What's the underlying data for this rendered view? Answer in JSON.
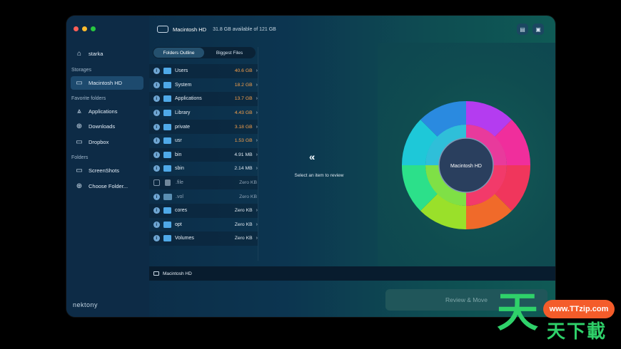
{
  "window": {
    "lights": [
      "#ff5f57",
      "#febc2e",
      "#28c840"
    ]
  },
  "sidebar": {
    "user": {
      "icon": "home-icon",
      "label": "starka"
    },
    "storages_heading": "Storages",
    "storage_item": {
      "icon": "drive-icon",
      "label": "Macintosh HD"
    },
    "favorites_heading": "Favorite folders",
    "favorites": [
      {
        "icon": "applications-icon",
        "label": "Applications"
      },
      {
        "icon": "download-icon",
        "label": "Downloads"
      },
      {
        "icon": "folder-icon",
        "label": "Dropbox"
      }
    ],
    "folders_heading": "Folders",
    "folders": [
      {
        "icon": "folder-icon",
        "label": "ScreenShots"
      },
      {
        "icon": "plus-circle-icon",
        "label": "Choose Folder..."
      }
    ],
    "brand": "nektony"
  },
  "topbar": {
    "title": "Macintosh HD",
    "available": "31.8 GB available of 121 GB"
  },
  "tabs": [
    "Folders Outline",
    "Biggest Files"
  ],
  "rows": [
    {
      "name": "Users",
      "size": "40.6 GB",
      "kind": "folder",
      "size_style": "warn"
    },
    {
      "name": "System",
      "size": "18.2 GB",
      "kind": "folder",
      "size_style": "warn"
    },
    {
      "name": "Applications",
      "size": "13.7 GB",
      "kind": "folder",
      "size_style": "warn"
    },
    {
      "name": "Library",
      "size": "4.43 GB",
      "kind": "folder",
      "size_style": "warn"
    },
    {
      "name": "private",
      "size": "3.18 GB",
      "kind": "folder",
      "size_style": "warn"
    },
    {
      "name": "usr",
      "size": "1.53 GB",
      "kind": "folder",
      "size_style": "warn"
    },
    {
      "name": "bin",
      "size": "4.91 MB",
      "kind": "folder",
      "size_style": "norm"
    },
    {
      "name": "sbin",
      "size": "2.14 MB",
      "kind": "folder",
      "size_style": "norm"
    },
    {
      "name": ".file",
      "size": "Zero KB",
      "kind": "file",
      "size_style": "dim"
    },
    {
      "name": ".vol",
      "size": "Zero KB",
      "kind": "hidden",
      "size_style": "dim"
    },
    {
      "name": "cores",
      "size": "Zero KB",
      "kind": "folder",
      "size_style": "norm"
    },
    {
      "name": "opt",
      "size": "Zero KB",
      "kind": "folder",
      "size_style": "norm"
    },
    {
      "name": "Volumes",
      "size": "Zero KB",
      "kind": "folder",
      "size_style": "norm"
    }
  ],
  "center": {
    "icon": "chevrons-left-icon",
    "prompt": "Select an item to review"
  },
  "chart_center_label": "Macintosh HD",
  "bottom_bar": {
    "label": "Macintosh HD"
  },
  "review_button": "Review & Move",
  "watermark": {
    "pill": "www.TTzip.com",
    "big": "天",
    "small": "天下載"
  }
}
